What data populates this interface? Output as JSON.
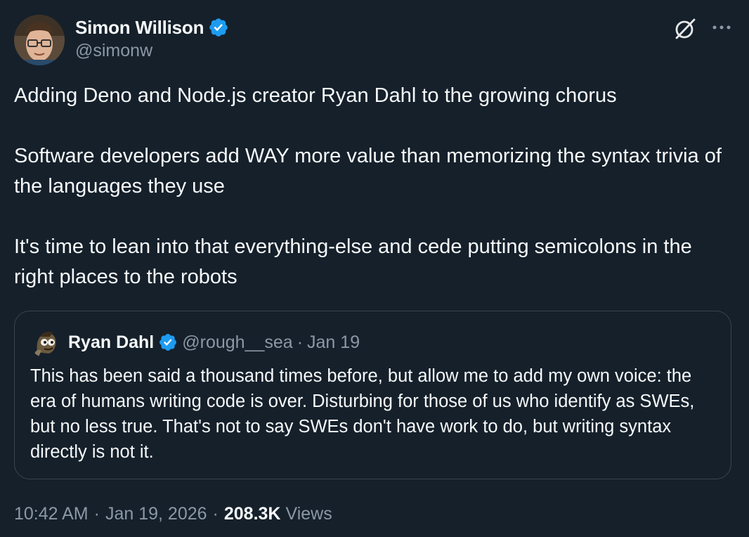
{
  "author": {
    "name": "Simon Willison",
    "handle": "@simonw",
    "verified": true
  },
  "icons": {
    "verified": "verified-badge-icon",
    "grok": "grok-icon",
    "more": "more-options-icon"
  },
  "colors": {
    "background": "#15202b",
    "text": "#f7f9f9",
    "secondary": "#8b98a5",
    "verified": "#1d9bf0",
    "border": "#38444d"
  },
  "tweet": {
    "paragraphs": [
      "Adding Deno and Node.js creator Ryan Dahl to the growing chorus",
      "Software developers add WAY more value than memorizing the syntax trivia of the languages they use",
      "It's time to lean into that everything-else and cede putting semicolons in the right places to the robots"
    ]
  },
  "quote": {
    "name": "Ryan Dahl",
    "handle": "@rough__sea",
    "dot": "·",
    "date": "Jan 19",
    "text": "This has been said a thousand times before, but allow me to add my own voice: the era of humans writing code is over. Disturbing for those of us who identify as SWEs, but no less true. That's not to say SWEs don't have work to do, but writing syntax directly is not it."
  },
  "meta": {
    "time": "10:42 AM",
    "sep1": "·",
    "date": "Jan 19, 2026",
    "sep2": "·",
    "views_count": "208.3K",
    "views_label": "Views"
  }
}
